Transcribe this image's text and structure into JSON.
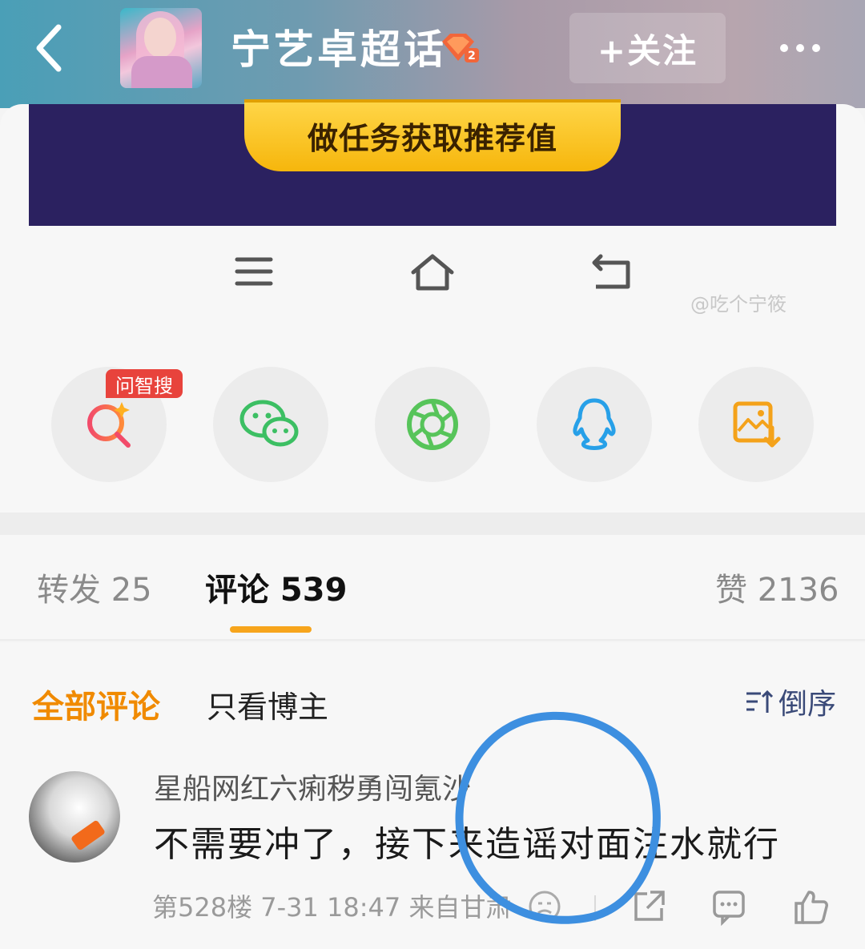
{
  "header": {
    "topic_title": "宁艺卓超话",
    "follow_label": "+关注",
    "badge_level": "2"
  },
  "banner": {
    "task_button_label": "做任务获取推荐值"
  },
  "watermark": "@吃个宁筱",
  "share": {
    "ai_tag": "问智搜"
  },
  "tabs": {
    "repost": "转发 25",
    "comment": "评论 539",
    "like": "赞 2136"
  },
  "filters": {
    "all": "全部评论",
    "blogger_only": "只看博主",
    "sort": "倒序"
  },
  "comment": {
    "username": "星船网红六痢秽勇闯氪沙",
    "text": "不需要冲了，接下来造谣对面注水就行",
    "meta": "第528楼 7-31 18:47 来自甘肃"
  },
  "colors": {
    "accent_orange": "#f08a00",
    "tab_indicator": "#f7a51c",
    "banner_bg": "#2b2160",
    "annotation_blue": "#3d8fe0"
  }
}
